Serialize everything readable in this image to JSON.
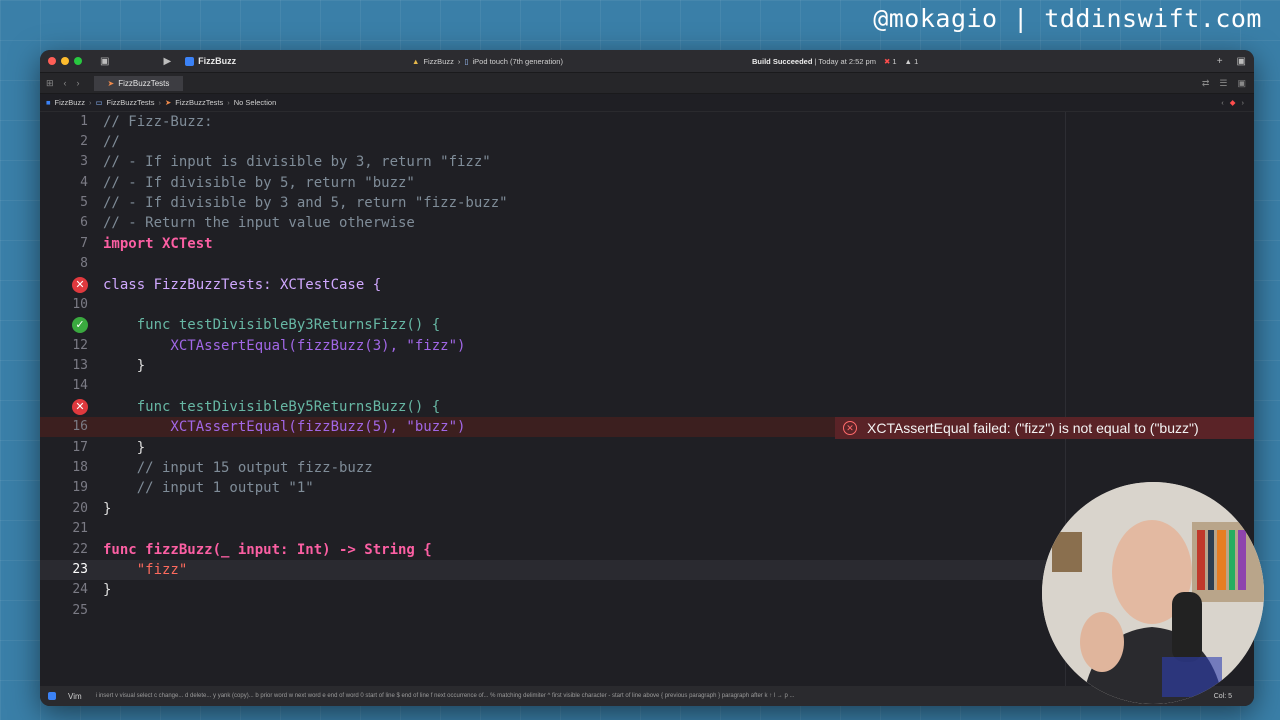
{
  "watermark": "@mokagio | tddinswift.com",
  "titlebar": {
    "scheme": "FizzBuzz",
    "destination_app": "FizzBuzz",
    "destination_device": "iPod touch (7th generation)",
    "status_bold": "Build Succeeded",
    "status_time": "Today at 2:52 pm",
    "error_count": "1",
    "warning_count": "1"
  },
  "tab": {
    "label": "FizzBuzzTests"
  },
  "jumpbar": {
    "project": "FizzBuzz",
    "group": "FizzBuzzTests",
    "file": "FizzBuzzTests",
    "selection": "No Selection"
  },
  "editor": {
    "current_line": 23,
    "lines": [
      "// Fizz-Buzz:",
      "//",
      "// - If input is divisible by 3, return \"fizz\"",
      "// - If divisible by 5, return \"buzz\"",
      "// - If divisible by 3 and 5, return \"fizz-buzz\"",
      "// - Return the input value otherwise",
      "import XCTest",
      "",
      "class FizzBuzzTests: XCTestCase {",
      "",
      "    func testDivisibleBy3ReturnsFizz() {",
      "        XCTAssertEqual(fizzBuzz(3), \"fizz\")",
      "    }",
      "",
      "    func testDivisibleBy5ReturnsBuzz() {",
      "        XCTAssertEqual(fizzBuzz(5), \"buzz\")",
      "    }",
      "    // input 15 output fizz-buzz",
      "    // input 1 output \"1\"",
      "}",
      "",
      "func fizzBuzz(_ input: Int) -> String {",
      "    \"fizz\"",
      "}",
      ""
    ],
    "error_message": "XCTAssertEqual failed: (\"fizz\") is not equal to (\"buzz\")"
  },
  "bottombar": {
    "mode": "Vim",
    "hints": "i insert   v visual select   c change...   d delete...   y yank (copy)...   b prior word   w next word   e end of word   0 start of line   $ end of line   f next occurrence of...   % matching delimiter   ^ first visible character   - start of line above   { previous paragraph   } paragraph after   k  ↑   l  →   p ...",
    "position": "Col: 5"
  },
  "colors": {
    "background": "#3a7fa8",
    "editor_bg": "#1f1f24",
    "error": "#e0393e",
    "success": "#3aa93f",
    "keyword": "#fc5fa3",
    "string": "#fc6a5d"
  }
}
